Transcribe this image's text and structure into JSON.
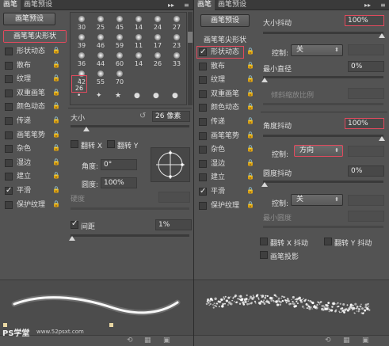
{
  "left_panel": {
    "tabs": [
      "画笔",
      "画笔预设"
    ],
    "preset_button": "画笔预设",
    "tip_shape_item": "画笔笔尖形状",
    "options": [
      {
        "label": "形状动态",
        "checked": false
      },
      {
        "label": "散布",
        "checked": false
      },
      {
        "label": "纹理",
        "checked": false
      },
      {
        "label": "双重画笔",
        "checked": false
      },
      {
        "label": "颜色动态",
        "checked": false
      },
      {
        "label": "传递",
        "checked": false
      },
      {
        "label": "画笔笔势",
        "checked": false
      },
      {
        "label": "杂色",
        "checked": false
      },
      {
        "label": "湿边",
        "checked": false
      },
      {
        "label": "建立",
        "checked": false
      },
      {
        "label": "平滑",
        "checked": true
      },
      {
        "label": "保护纹理",
        "checked": false
      }
    ],
    "brush_sizes": [
      "30",
      "25",
      "45",
      "14",
      "24",
      "27",
      "39",
      "46",
      "59",
      "11",
      "17",
      "23",
      "36",
      "44",
      "60",
      "14",
      "26",
      "33",
      "42",
      "55",
      "70"
    ],
    "size_label": "大小",
    "size_value": "26 像素",
    "flip_x": "翻转 X",
    "flip_y": "翻转 Y",
    "angle_label": "角度:",
    "angle_value": "0°",
    "roundness_label": "圆度:",
    "roundness_value": "100%",
    "hardness_label": "硬度",
    "spacing_label": "间距",
    "spacing_value": "1%",
    "watermark": "PS学堂",
    "watermark_url": "www.52psxt.com"
  },
  "right_panel": {
    "tabs": [
      "画笔",
      "画笔预设"
    ],
    "preset_button": "画笔预设",
    "tip_shape_item": "画笔笔尖形状",
    "options": [
      {
        "label": "形状动态",
        "checked": true
      },
      {
        "label": "散布",
        "checked": false
      },
      {
        "label": "纹理",
        "checked": false
      },
      {
        "label": "双重画笔",
        "checked": false
      },
      {
        "label": "颜色动态",
        "checked": false
      },
      {
        "label": "传递",
        "checked": false
      },
      {
        "label": "画笔笔势",
        "checked": false
      },
      {
        "label": "杂色",
        "checked": false
      },
      {
        "label": "湿边",
        "checked": false
      },
      {
        "label": "建立",
        "checked": false
      },
      {
        "label": "平滑",
        "checked": true
      },
      {
        "label": "保护纹理",
        "checked": false
      }
    ],
    "size_jitter_label": "大小抖动",
    "size_jitter_value": "100%",
    "control_label": "控制:",
    "control1_value": "关",
    "min_diameter_label": "最小直径",
    "min_diameter_value": "0%",
    "tilt_scale_label": "倾斜缩放比例",
    "angle_jitter_label": "角度抖动",
    "angle_jitter_value": "100%",
    "control2_value": "方向",
    "roundness_jitter_label": "圆度抖动",
    "roundness_jitter_value": "0%",
    "control3_value": "关",
    "min_roundness_label": "最小圆度",
    "flip_x_jitter": "翻转 X 抖动",
    "flip_y_jitter": "翻转 Y 抖动",
    "brush_projection": "画笔投影"
  }
}
